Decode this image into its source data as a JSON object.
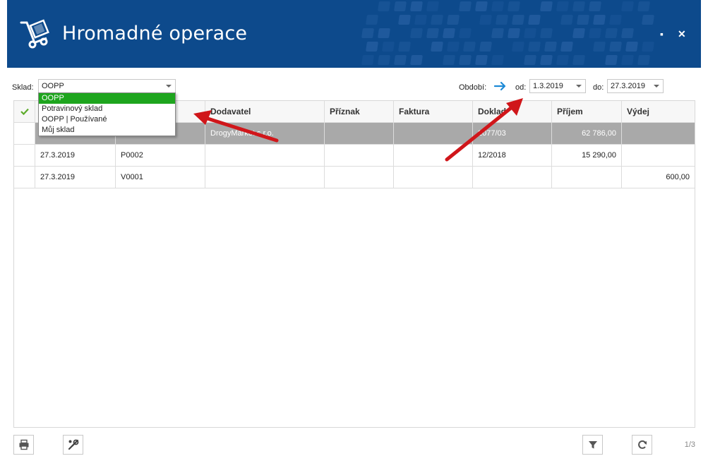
{
  "header": {
    "title": "Hromadné operace",
    "maximize_icon": "maximize-icon",
    "close_icon": "close-icon",
    "close_label": "✕",
    "maximize_label": "▪"
  },
  "toolbar": {
    "sklad_label": "Sklad:",
    "sklad_value": "OOPP",
    "obdobi_label": "Období:",
    "od_label": "od:",
    "od_value": "1.3.2019",
    "do_label": "do:",
    "do_value": "27.3.2019"
  },
  "dropdown": {
    "options": [
      "OOPP",
      "Potravinový sklad",
      "OOPP | Používané",
      "Můj sklad"
    ],
    "selected": "OOPP"
  },
  "grid": {
    "columns": [
      "",
      "",
      "",
      "Dodavatel",
      "Příznak",
      "Faktura",
      "Doklad",
      "Příjem",
      "Výdej"
    ],
    "rows": [
      [
        "",
        "",
        "",
        "DrogyMarket s.r.o.",
        "",
        "",
        "2077/03",
        "62 786,00",
        ""
      ],
      [
        "",
        "27.3.2019",
        "P0002",
        "",
        "",
        "",
        "12/2018",
        "15 290,00",
        ""
      ],
      [
        "",
        "27.3.2019",
        "V0001",
        "",
        "",
        "",
        "",
        "",
        "600,00"
      ]
    ]
  },
  "footer": {
    "pager": "1/3"
  },
  "colors": {
    "header_bg": "#0d4a8c",
    "selected_option": "#1ea51e",
    "highlight_row": "#a9a9a9",
    "annotation_arrow": "#d0161a"
  }
}
